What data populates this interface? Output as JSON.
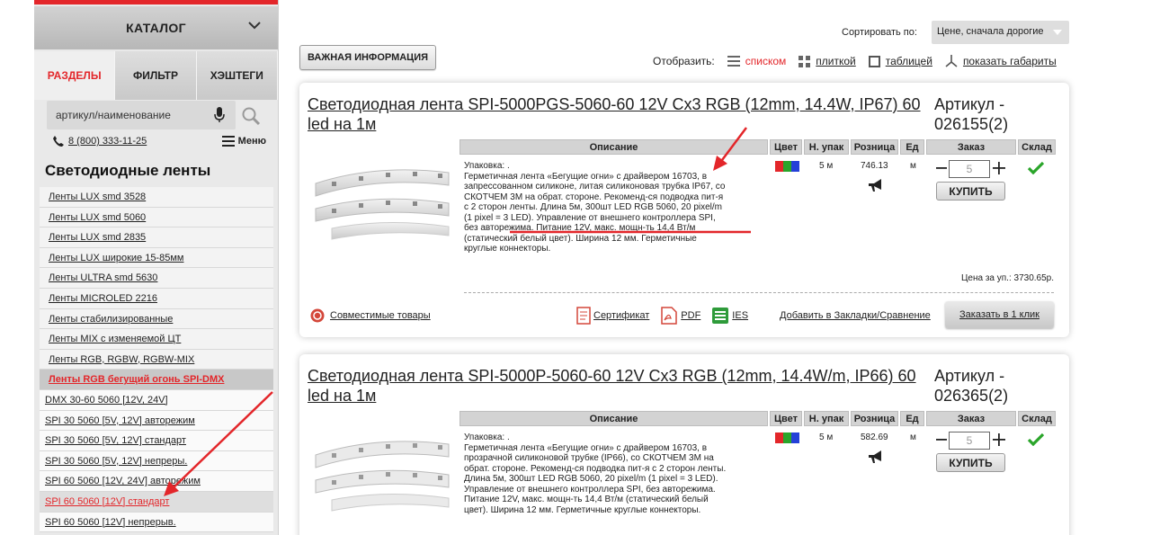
{
  "sidebar": {
    "catalog_label": "КАТАЛОГ",
    "tabs": [
      "РАЗДЕЛЫ",
      "ФИЛЬТР",
      "ХЭШТЕГИ"
    ],
    "search_value": "артикул/наименование",
    "phone": "8 (800) 333-11-25",
    "menu_label": "Меню",
    "section_title": "Светодиодные ленты",
    "items": [
      "Ленты LUX smd 3528",
      "Ленты LUX smd 5060",
      "Ленты LUX smd 2835",
      "Ленты LUX широкие 15-85мм",
      "Ленты ULTRA smd 5630",
      "Ленты MICROLED 2216",
      "Ленты стабилизированные",
      "Ленты MIX с изменяемой ЦТ",
      "Ленты RGB, RGBW, RGBW-MIX",
      "Ленты RGB бегущий огонь SPI-DMX",
      "DMX 30-60 5060 [12V, 24V]",
      "SPI 30 5060 [5V, 12V] авторежим",
      "SPI 30 5060 [5V, 12V] стандарт",
      "SPI 30 5060 [5V, 12V] непреры.",
      "SPI 60 5060 [12V, 24V] авторежим",
      "SPI 60 5060 [12V] стандарт",
      "SPI 60 5060 [12V] непрерыв."
    ]
  },
  "toolbar": {
    "sort_label": "Сортировать по:",
    "sort_value": "Цене, сначала дорогие",
    "important_label": "ВАЖНАЯ ИНФОРМАЦИЯ",
    "view_label": "Отобразить:",
    "view_list": "списком",
    "view_tile": "плиткой",
    "view_table": "таблицей",
    "view_dims": "показать габариты"
  },
  "columns": {
    "description": "Описание",
    "color": "Цвет",
    "pack": "Н. упак",
    "retail": "Розница",
    "unit": "Ед",
    "order": "Заказ",
    "stock": "Склад"
  },
  "products": [
    {
      "title": "Светодиодная лента SPI-5000PGS-5060-60 12V Cx3 RGB (12mm, 14.4W, IP67) 60 led на 1м",
      "article_label": "Артикул -",
      "article": "026155(2)",
      "description_lines": [
        "Упаковка: .",
        "Герметичная лента «Бегущие огни» с драйвером 16703, в",
        "запрессованном силиконе, литая силиконовая трубка IP67, со",
        "СКОТЧЕМ 3М на обрат. стороне. Рекоменд-ся подводка пит-я",
        "с 2 сторон ленты. Длина 5м, 300шт LED RGB 5060, 20 pixel/m",
        "(1 pixel = 3 LED). Управление от внешнего контроллера SPI,",
        "без авторежима. Питание 12V, макс. мощн-ть 14,4 Вт/м",
        "(статический белый цвет). Ширина 12 мм. Герметичные",
        "круглые коннекторы."
      ],
      "pack": "5 м",
      "price": "746.13",
      "unit": "м",
      "qty": "5",
      "buy_label": "КУПИТЬ",
      "unit_price": "Цена за уп.: 3730.65р.",
      "compat_label": "Совместимые товары",
      "cert_label": "Сертификат",
      "pdf_label": "PDF",
      "ies_label": "IES",
      "bookmark_label": "Добавить в Закладки/Сравнение",
      "oneclick_label": "Заказать в 1 клик"
    },
    {
      "title": "Светодиодная лента SPI-5000P-5060-60 12V Cx3 RGB (12mm, 14.4W/m, IP66) 60 led на 1м",
      "article_label": "Артикул -",
      "article": "026365(2)",
      "description_lines": [
        "Упаковка: .",
        "Герметичная лента «Бегущие огни» с драйвером 16703, в",
        "прозрачной силиконовой трубке (IP66), со СКОТЧЕМ 3М на",
        "обрат. стороне. Рекоменд-ся подводка пит-я с 2 сторон ленты.",
        "Длина 5м, 300шт LED RGB 5060, 20 pixel/m (1 pixel = 3 LED).",
        "Управление от внешнего контроллера SPI, без авторежима.",
        "Питание 12V, макс. мощн-ть 14,4 Вт/м (статический белый",
        "цвет). Ширина 12 мм. Герметичные круглые коннекторы."
      ],
      "pack": "5 м",
      "price": "582.69",
      "unit": "м",
      "qty": "5",
      "buy_label": "КУПИТЬ"
    }
  ],
  "colors": {
    "accent": "#e3262a",
    "sidebar_bg": "#e9e9e9",
    "header_bg": "#d3d3d3",
    "check": "#2aa52a"
  }
}
